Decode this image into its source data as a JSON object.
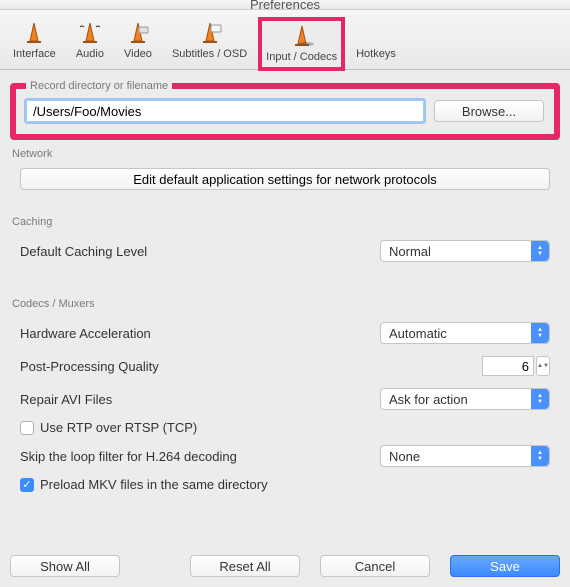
{
  "window": {
    "title": "Preferences"
  },
  "toolbar": {
    "items": [
      {
        "label": "Interface"
      },
      {
        "label": "Audio"
      },
      {
        "label": "Video"
      },
      {
        "label": "Subtitles / OSD"
      },
      {
        "label": "Input / Codecs"
      },
      {
        "label": "Hotkeys"
      }
    ]
  },
  "record": {
    "legend": "Record directory or filename",
    "value": "/Users/Foo/Movies",
    "browse": "Browse..."
  },
  "network": {
    "label": "Network",
    "button": "Edit default application settings for network protocols"
  },
  "caching": {
    "label": "Caching",
    "level_label": "Default Caching Level",
    "level_value": "Normal"
  },
  "codecs": {
    "label": "Codecs / Muxers",
    "hwaccel_label": "Hardware Acceleration",
    "hwaccel_value": "Automatic",
    "postproc_label": "Post-Processing Quality",
    "postproc_value": "6",
    "repair_label": "Repair AVI Files",
    "repair_value": "Ask for action",
    "rtp_label": "Use RTP over RTSP (TCP)",
    "rtp_checked": false,
    "loop_label": "Skip the loop filter for H.264 decoding",
    "loop_value": "None",
    "mkv_label": "Preload MKV files in the same directory",
    "mkv_checked": true
  },
  "footer": {
    "show_all": "Show All",
    "reset_all": "Reset All",
    "cancel": "Cancel",
    "save": "Save"
  }
}
